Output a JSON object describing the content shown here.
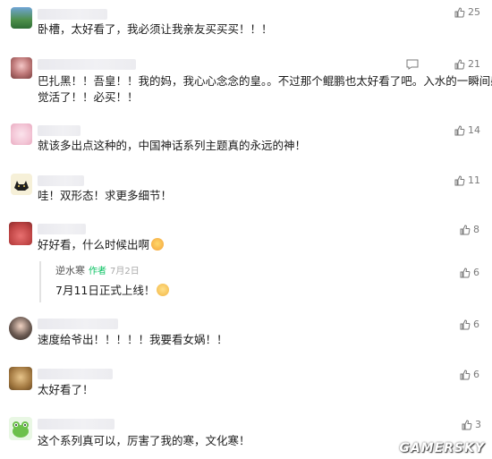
{
  "comments": [
    {
      "text": "卧槽，太好看了，我必须让我亲友买买买！！！",
      "likes": "25"
    },
    {
      "text_line1": "巴扎黑！！吾皇！！我的妈，我心心念念的皇。。不过那个鲲鹏也太好看了吧。入水的一瞬间感",
      "text_line2": "觉活了！！必买！！",
      "likes": "21"
    },
    {
      "text": "就该多出点这种的，中国神话系列主题真的永远的神！",
      "likes": "14"
    },
    {
      "text": "哇！双形态！求更多细节！",
      "likes": "11"
    },
    {
      "text": "好好看，什么时候出啊",
      "likes": "8"
    },
    {
      "reply_name": "逆水寒",
      "reply_tag": "作者",
      "reply_date": "7月2日",
      "text": "7月11日正式上线！",
      "likes": "6"
    },
    {
      "text": "速度给爷出！！！！！我要看女娲！！",
      "likes": "6"
    },
    {
      "text": "太好看了！",
      "likes": "6"
    },
    {
      "text": "这个系列真可以，厉害了我的寒，文化寒！",
      "likes": "3"
    }
  ],
  "icons": {
    "like": "thumb-up-icon",
    "message": "message-icon"
  },
  "watermark": "GAMERSKY"
}
